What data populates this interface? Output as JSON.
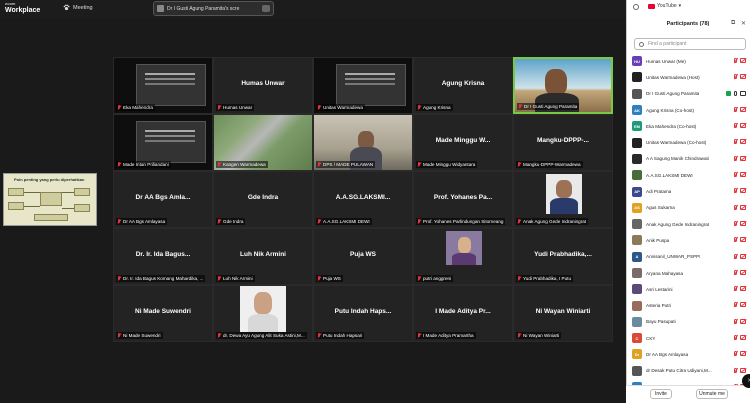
{
  "app": {
    "brand_top": "zoom",
    "brand_name": "Workplace"
  },
  "topbar": {
    "meeting_label": "Meeting",
    "speaker_pill": "Dr I Gusti Agung Paramita's scre"
  },
  "panel": {
    "youtube_label": "YouTube",
    "title": "Participants (78)",
    "search_placeholder": "Find a participant",
    "invite_label": "Invite",
    "unmute_label": "Unmute me"
  },
  "participants": [
    {
      "initials": "HU",
      "color": "#6a3fb5",
      "name": "Humas Unwar (Me)",
      "mic": "muted",
      "video": "off"
    },
    {
      "initials": "",
      "color": "#222222",
      "name": "Unitas Warmadewa (Host)",
      "mic": "muted",
      "video": "off"
    },
    {
      "initials": "",
      "color": "#555555",
      "name": "Dr I Gusti Agung Paramita",
      "mic": "on",
      "video": "on",
      "badge": true
    },
    {
      "initials": "AK",
      "color": "#2e7fbf",
      "name": "Agung Krisna (Co-host)",
      "mic": "muted",
      "video": "off"
    },
    {
      "initials": "EM",
      "color": "#1f9b7a",
      "name": "Eka Mahendra (Co-host)",
      "mic": "muted",
      "video": "off"
    },
    {
      "initials": "",
      "color": "#222222",
      "name": "Unitas Warmadewa (Co-host)",
      "mic": "muted",
      "video": "off"
    },
    {
      "initials": "",
      "color": "#2a2a2a",
      "name": "A A Sagung Manik Chindrawati",
      "mic": "muted",
      "video": "off"
    },
    {
      "initials": "",
      "color": "#4a6b3a",
      "name": "A.A.SG.LAKSMI DEWI",
      "mic": "muted",
      "video": "off"
    },
    {
      "initials": "AP",
      "color": "#3b4a8a",
      "name": "Adi Pratama",
      "mic": "muted",
      "video": "off"
    },
    {
      "initials": "AS",
      "color": "#e0a020",
      "name": "Agus Sukarna",
      "mic": "muted",
      "video": "off"
    },
    {
      "initials": "",
      "color": "#666666",
      "name": "Anak Agung Gede Indraningrat",
      "mic": "muted",
      "video": "off"
    },
    {
      "initials": "",
      "color": "#8a7a5a",
      "name": "Anik Puspa",
      "mic": "muted",
      "video": "off"
    },
    {
      "initials": "A",
      "color": "#2b5a8a",
      "name": "Annisanil_UNWAR_PSPPI",
      "mic": "muted",
      "video": "off"
    },
    {
      "initials": "",
      "color": "#7a6a6a",
      "name": "Aryana Mahayasa",
      "mic": "muted",
      "video": "off"
    },
    {
      "initials": "",
      "color": "#5a4a7a",
      "name": "Asri Lestarini",
      "mic": "muted",
      "video": "off"
    },
    {
      "initials": "",
      "color": "#9a6a5a",
      "name": "Asteria Putri",
      "mic": "muted",
      "video": "off"
    },
    {
      "initials": "",
      "color": "#6a8aa0",
      "name": "Bayu Pasupati",
      "mic": "muted",
      "video": "off"
    },
    {
      "initials": "C",
      "color": "#d94a3a",
      "name": "CKY",
      "mic": "muted",
      "video": "off"
    },
    {
      "initials": "Dr",
      "color": "#e0a020",
      "name": "Dr AA Bgs Amlayasa",
      "mic": "muted",
      "video": "off"
    },
    {
      "initials": "",
      "color": "#555555",
      "name": "dr Desak Putu Citra Udiyani,M...",
      "mic": "muted",
      "video": "off"
    },
    {
      "initials": "",
      "color": "#2e7fbf",
      "name": "dr Indah",
      "mic": "muted",
      "video": "off"
    }
  ],
  "slide": {
    "title": "Poin penting yang perlu diperhatikan"
  },
  "tiles": [
    {
      "kind": "poster",
      "name": "",
      "label": "Eka Mahendra",
      "active": false
    },
    {
      "kind": "blank",
      "name": "Humas Unwar",
      "label": "Humas Unwar",
      "active": false
    },
    {
      "kind": "poster",
      "name": "",
      "label": "Unitas Warmadewa",
      "active": false
    },
    {
      "kind": "blank",
      "name": "Agung Krisna",
      "label": "Agung Krisna",
      "active": false
    },
    {
      "kind": "sky",
      "name": "",
      "label": "Dr I Gusti Agung Paramita",
      "active": true
    },
    {
      "kind": "poster",
      "name": "",
      "label": "Made Intan Priliandani",
      "active": false
    },
    {
      "kind": "aerial",
      "name": "",
      "label": "Kangen Warmadewa",
      "active": false
    },
    {
      "kind": "room",
      "name": "",
      "label": "DPS / MADE PULAWAN",
      "active": false
    },
    {
      "kind": "blank",
      "name": "Made Minggu W...",
      "label": "Made Minggu Widyantara",
      "active": false
    },
    {
      "kind": "blank",
      "name": "Mangku-DPPP-...",
      "label": "Mangku-DPPP-Warmadewa",
      "active": false
    },
    {
      "kind": "blank",
      "name": "Dr AA Bgs Amla...",
      "label": "Dr AA Bgs Amlayasa",
      "active": false
    },
    {
      "kind": "blank",
      "name": "Gde Indra",
      "label": "Gde Indra",
      "active": false
    },
    {
      "kind": "blank",
      "name": "A.A.SG.LAKSMI...",
      "label": "A.A.SG.LAKSMI DEWI",
      "active": false
    },
    {
      "kind": "blank",
      "name": "Prof. Yohanes Pa...",
      "label": "Prof. Yohanes Parlindungan Sitorneang",
      "active": false
    },
    {
      "kind": "portrait",
      "name": "",
      "label": "Anak Agung Gede Indraningrat",
      "active": false
    },
    {
      "kind": "blank",
      "name": "Dr. Ir. Ida Bagus...",
      "label": "Dr. Ir. Ida Bagus Komang Mahardika, ...",
      "active": false
    },
    {
      "kind": "blank",
      "name": "Luh Nik Armini",
      "label": "Luh Nik Armini",
      "active": false
    },
    {
      "kind": "blank",
      "name": "Puja WS",
      "label": "Puja WS",
      "active": false
    },
    {
      "kind": "avatarpic",
      "name": "",
      "label": "putri anggreni",
      "active": false
    },
    {
      "kind": "blank",
      "name": "Yudi Prabhadika,...",
      "label": "Yudi Prabhadika, I Putu",
      "active": false
    },
    {
      "kind": "blank",
      "name": "Ni Made Suwendri",
      "label": "Ni Made Suwendri",
      "active": false
    },
    {
      "kind": "woman",
      "name": "",
      "label": "dr. Dewa Ayu Agung Alit Suka Astini,M...",
      "active": false
    },
    {
      "kind": "blank",
      "name": "Putu Indah Haps...",
      "label": "Putu Indah Hapsari",
      "active": false
    },
    {
      "kind": "blank",
      "name": "I Made Aditya Pr...",
      "label": "I Made Aditya Pramartha",
      "active": false
    },
    {
      "kind": "blank",
      "name": "Ni Wayan Winiarti",
      "label": "Ni Wayan Winiarti",
      "active": false
    }
  ]
}
